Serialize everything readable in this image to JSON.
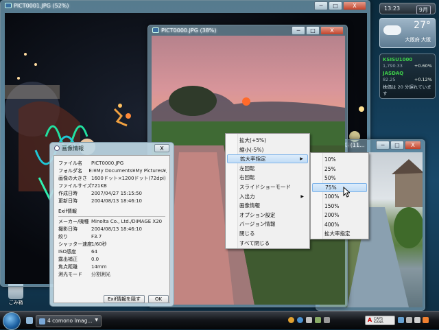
{
  "windows": {
    "win1": {
      "title": "PICT0001.JPG (52%)"
    },
    "win2": {
      "title": "PICT0000.JPG (38%)"
    },
    "win3": {
      "title": "PICT0 .JPG (11..."
    }
  },
  "controls": {
    "min": "─",
    "max": "□",
    "close": "X"
  },
  "dialog": {
    "title": "画像情報",
    "close": "X",
    "rows": [
      {
        "k": "ファイル名",
        "v": "PICT0000.JPG"
      },
      {
        "k": "フォルダ名",
        "v": "E:¥My Documents¥My Pictures¥見ﾆ"
      },
      {
        "k": "画像の大きさ",
        "v": "1600ドット×1200ドット(72dpi)"
      },
      {
        "k": "ファイルサイズ",
        "v": "721KB"
      },
      {
        "k": "作成日時",
        "v": "2007/04/27 15:15:50"
      },
      {
        "k": "更新日時",
        "v": "2004/08/13 18:46:10"
      }
    ],
    "exif_header": "Exif情報",
    "exif_rows": [
      {
        "k": "メーカー/機種",
        "v": "Minolta Co., Ltd./DiMAGE X20"
      },
      {
        "k": "撮影日時",
        "v": "2004/08/13 18:46:10"
      },
      {
        "k": "絞り",
        "v": "F3.7"
      },
      {
        "k": "シャッター速度",
        "v": "1/60秒"
      },
      {
        "k": "ISO感度",
        "v": "64"
      },
      {
        "k": "露出補正",
        "v": "0.0"
      },
      {
        "k": "焦点距離",
        "v": "14mm"
      },
      {
        "k": "測光モード",
        "v": "分割測光"
      }
    ],
    "hide_exif": "Exif情報を隠す",
    "ok": "OK"
  },
  "context_menu": {
    "items": [
      {
        "label": "拡大(+5%)"
      },
      {
        "label": "縮小(-5%)"
      },
      {
        "label": "拡大率指定",
        "arrow": "▶"
      },
      {
        "label": "左回転"
      },
      {
        "label": "右回転"
      },
      {
        "label": "スライドショーモード"
      },
      {
        "label": "入出力",
        "arrow": "▶"
      },
      {
        "label": "画像情報"
      },
      {
        "label": "オプション設定"
      },
      {
        "label": "バージョン情報"
      },
      {
        "label": "閉じる"
      },
      {
        "label": "すべて閉じる"
      }
    ]
  },
  "zoom_menu": {
    "items": [
      "10%",
      "25%",
      "50%",
      "75%",
      "100%",
      "150%",
      "200%",
      "400%",
      "拡大率指定"
    ]
  },
  "sidebar": {
    "clock": "13:23",
    "date": "9月",
    "weather_temp": "27°",
    "weather_city": "大阪府 大阪",
    "stocks": [
      {
        "name": "KSISU1000",
        "value": "1,790.33",
        "change": "+0.60%"
      },
      {
        "name": "JASDAQ",
        "value": "82.25",
        "change": "+0.12%"
      }
    ],
    "stock_note": "株価は 20 分遅れています"
  },
  "desktop": {
    "icon_label": "ごみ箱"
  },
  "taskbar": {
    "task_label": "4 comono Imag...",
    "ime": "A",
    "caps": "CAPS KANA"
  },
  "colors": {
    "highlight": "#c1dcf5",
    "stock_up": "#3fd24a"
  }
}
